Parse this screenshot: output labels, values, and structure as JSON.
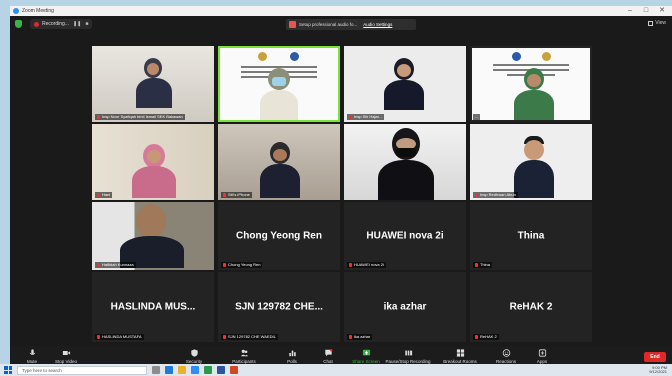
{
  "window": {
    "title": "Zoom Meeting",
    "controls": [
      "–",
      "□",
      "✕"
    ]
  },
  "top": {
    "recording_label": "Recording...",
    "recording_pause": "❚❚",
    "recording_stop": "■",
    "toast_text": "Setup professional audio fo...",
    "toast_link": "Audio Settings",
    "view_label": "View"
  },
  "tiles": [
    {
      "name": "Insp Noor Syafiqah binti Ismail SEK Bakawan",
      "big": ""
    },
    {
      "name": "",
      "big": ""
    },
    {
      "name": "Insp Siti Hajar...",
      "big": ""
    },
    {
      "name": "...",
      "big": ""
    },
    {
      "name": "Hani",
      "big": ""
    },
    {
      "name": "Siti's iPhone",
      "big": ""
    },
    {
      "name": "",
      "big": ""
    },
    {
      "name": "Insp Redhwan Abun",
      "big": ""
    },
    {
      "name": "Halfidah Kunnaza",
      "big": ""
    },
    {
      "name": "Chong Yeong Ren",
      "big": "Chong Yeong Ren"
    },
    {
      "name": "HUAWEI nova 2i",
      "big": "HUAWEI nova 2i"
    },
    {
      "name": "Thina",
      "big": "Thina"
    },
    {
      "name": "HASLINDA MUSTAFA",
      "big": "HASLINDA MUS..."
    },
    {
      "name": "SJN 129782 CHE WAEDIL",
      "big": "SJN 129782 CHE..."
    },
    {
      "name": "ika azhar",
      "big": "ika azhar"
    },
    {
      "name": "ReHAK 2",
      "big": "ReHAK 2"
    }
  ],
  "toolbar": {
    "items": [
      "Mute",
      "Stop Video",
      "Security",
      "Participants",
      "Polls",
      "Chat",
      "Share Screen",
      "Pause/Stop Recording",
      "Breakout Rooms",
      "Reactions",
      "Apps"
    ],
    "participants_count": "43",
    "end_label": "End"
  },
  "taskbar": {
    "search_placeholder": "Type here to search",
    "time": "9:00 PM",
    "date": "9/12/2021"
  },
  "colors": {
    "active_speaker": "#7be23a",
    "end": "#e02828",
    "record": "#e02828",
    "share": "#3db14a"
  }
}
